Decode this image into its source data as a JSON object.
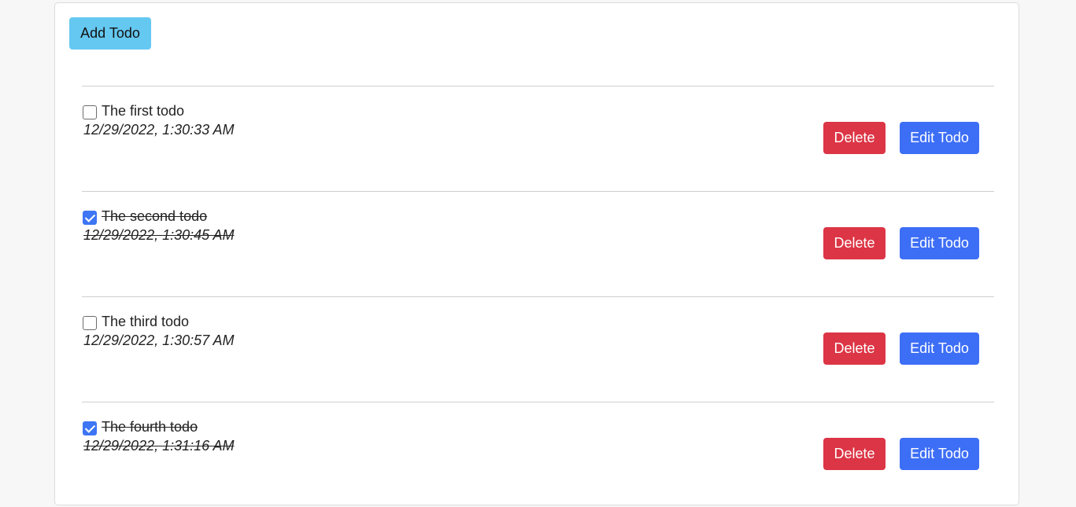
{
  "toolbar": {
    "add_label": "Add Todo"
  },
  "actions": {
    "delete_label": "Delete",
    "edit_label": "Edit Todo"
  },
  "colors": {
    "add": "#65c8f1",
    "delete": "#dc3545",
    "edit": "#3d6ef6",
    "checkbox": "#3d75f4"
  },
  "todos": [
    {
      "title": "The first todo",
      "date": "12/29/2022, 1:30:33 AM",
      "completed": false
    },
    {
      "title": "The second todo",
      "date": "12/29/2022, 1:30:45 AM",
      "completed": true
    },
    {
      "title": "The third todo",
      "date": "12/29/2022, 1:30:57 AM",
      "completed": false
    },
    {
      "title": "The fourth todo",
      "date": "12/29/2022, 1:31:16 AM",
      "completed": true
    }
  ]
}
